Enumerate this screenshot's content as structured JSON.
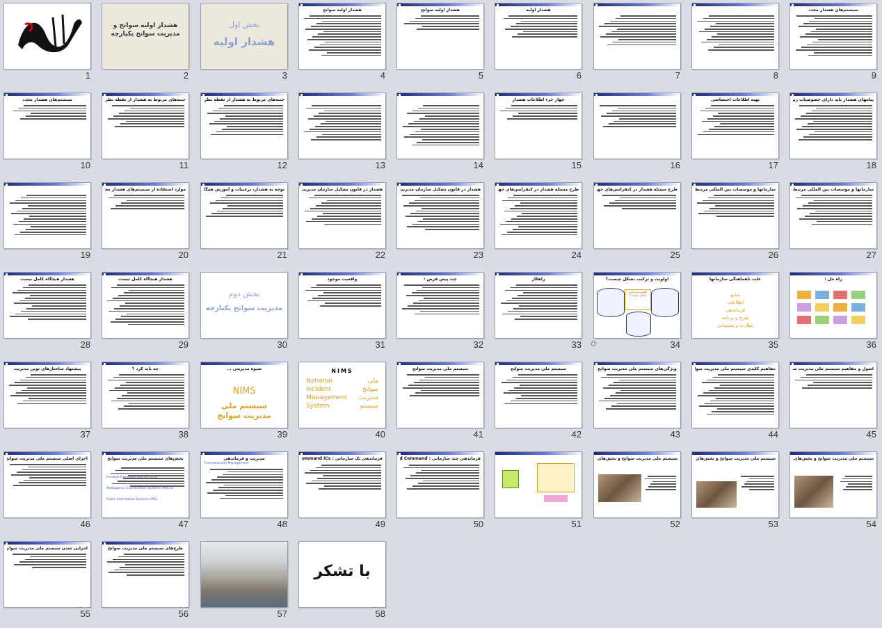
{
  "slides": [
    {
      "n": "1",
      "title": ""
    },
    {
      "n": "2",
      "title": "هشدار اولیه سوانح و مدیریت سوانح یکپارچه"
    },
    {
      "n": "3",
      "title": "بخش اول",
      "subtitle": "هشدار اولیه"
    },
    {
      "n": "4",
      "title": "هشدار اولیه سوانح"
    },
    {
      "n": "5",
      "title": "هشدار اولیه سوانح"
    },
    {
      "n": "6",
      "title": "هشدار اولیه"
    },
    {
      "n": "7",
      "title": ""
    },
    {
      "n": "8",
      "title": ""
    },
    {
      "n": "9",
      "title": "سیستم‌های هشدار مجدد"
    },
    {
      "n": "10",
      "title": "سیستم‌های هشدار مجدد"
    },
    {
      "n": "11",
      "title": "جنبه‌های مربوط به هشدار از نقطه نظر آمادگی"
    },
    {
      "n": "12",
      "title": "جنبه‌های مربوط به هشدار از نقطه نظر آمادگی"
    },
    {
      "n": "13",
      "title": ""
    },
    {
      "n": "14",
      "title": ""
    },
    {
      "n": "15",
      "title": "چهار جزء اطلاعات هشدار"
    },
    {
      "n": "16",
      "title": ""
    },
    {
      "n": "17",
      "title": "تهیه اطلاعات اختصاصی"
    },
    {
      "n": "18",
      "title": "پیامهای هشدار باید دارای خصوصیات زیر باشند"
    },
    {
      "n": "19",
      "title": ""
    },
    {
      "n": "20",
      "title": "موارد استفاده از سیستم‌های هشدار مجدد"
    },
    {
      "n": "21",
      "title": "توجه به هشدار، ترغیبات و آموزش همگانی"
    },
    {
      "n": "22",
      "title": "هشدار در قانون تشکیل سازمان مدیریت بحران کشور و آئین نامه اجرایی آن"
    },
    {
      "n": "23",
      "title": "هشدار در قانون تشکیل سازمان مدیریت بحران کشور و آئین نامه اجرایی آن"
    },
    {
      "n": "24",
      "title": "طرح مسئله هشدار در کنفرانس‌های جهانی"
    },
    {
      "n": "25",
      "title": "طرح مسئله هشدار در کنفرانس‌های جهانی ..."
    },
    {
      "n": "26",
      "title": "سازمانها و موسسات بین المللی مرتبط با امر هشدار"
    },
    {
      "n": "27",
      "title": "سازمانها و موسسات بین المللی مرتبط با امر هشدار"
    },
    {
      "n": "28",
      "title": "هشدار هیچگاه کامل نیست"
    },
    {
      "n": "29",
      "title": "هشدار هیچگاه کامل نیست"
    },
    {
      "n": "30",
      "title": "بخش دوم",
      "subtitle": "مدیریت سوانح یکپارچه"
    },
    {
      "n": "31",
      "title": "واقعیت موجود"
    },
    {
      "n": "32",
      "title": "چند پیش فرض :"
    },
    {
      "n": "33",
      "title": "راهکار"
    },
    {
      "n": "34",
      "title": "اولویت و ترکیب تشکل چیست؟"
    },
    {
      "n": "35",
      "title": "علت ناهماهنگی سازمانها"
    },
    {
      "n": "36",
      "title": "راه حل :"
    },
    {
      "n": "37",
      "title": "پیشنهاد ساختارهای نوین مدیریت"
    },
    {
      "n": "38",
      "title": "چه باید کرد ؟"
    },
    {
      "n": "39",
      "title": "شیوه مدیریتی ...",
      "subtitle": "سیستم ملی مدیریت سوانح"
    },
    {
      "n": "40",
      "title": "NIMS"
    },
    {
      "n": "41",
      "title": "سیستم ملی مدیریت سوانح"
    },
    {
      "n": "42",
      "title": "سیستم ملی مدیریت سوانح"
    },
    {
      "n": "43",
      "title": "ویژگی‌های سیستم ملی مدیریت سوانح"
    },
    {
      "n": "44",
      "title": "مفاهیم کلیدی سیستم ملی مدیریت سوانح"
    },
    {
      "n": "45",
      "title": "اصول و مفاهیم سیستم ملی مدیریت سوانح"
    },
    {
      "n": "46",
      "title": "اجزای اصلی سیستم ملی مدیریت سوانح"
    },
    {
      "n": "47",
      "title": "بخش‌های سیستم ملی مدیریت سوانح"
    },
    {
      "n": "48",
      "title": "مدیریت و فرماندهی"
    },
    {
      "n": "49",
      "title": "فرماندهی تک سازمانی : Single Command ICs"
    },
    {
      "n": "50",
      "title": "فرماندهی چند سازمانی : Unified Command"
    },
    {
      "n": "51",
      "title": ""
    },
    {
      "n": "52",
      "title": "سیستم ملی مدیریت سوانح و بخش‌های آن"
    },
    {
      "n": "53",
      "title": "سیستم ملی مدیریت سوانح و بخش‌های آن"
    },
    {
      "n": "54",
      "title": "سیستم ملی مدیریت سوانح و بخش‌های آن"
    },
    {
      "n": "55",
      "title": "اجرایی شدن سیستم ملی مدیریت سوانح"
    },
    {
      "n": "56",
      "title": "طرح‌های سیستم ملی مدیریت سوانح"
    },
    {
      "n": "57",
      "title": ""
    },
    {
      "n": "58",
      "title": "با تشکر"
    }
  ],
  "special": {
    "s34_box": "اولویت و ترکیب تشکل چیست؟",
    "s35_items": [
      "منابع",
      "اطلاعات",
      "فرماندهی",
      "طرح و برنامه",
      "نظارت و پشتیبانی"
    ],
    "s39_big": "NIMS",
    "s39_sub": "سیستم ملی مدیریت سوانح",
    "s40_en": [
      "National",
      "Incident",
      "Management",
      "System"
    ],
    "s40_fa": [
      "ملی",
      "سوانح",
      "مدیریت",
      "سیستم"
    ],
    "s47_lines": [
      "Incident Command System (ICS)",
      "Multiagency Coordination Systems (MACS)",
      "Public Information Systems (PIS)"
    ],
    "s48_en": "Command and Management",
    "s49_en": "Single Command ICs",
    "s50_en": "Unified Command",
    "s58_text": "با تشکر"
  },
  "colors": {
    "accent_dark": "#1b2a7a",
    "title_blue": "#8aa1d6",
    "gold": "#e0a020",
    "selection": "#f3b54a"
  }
}
